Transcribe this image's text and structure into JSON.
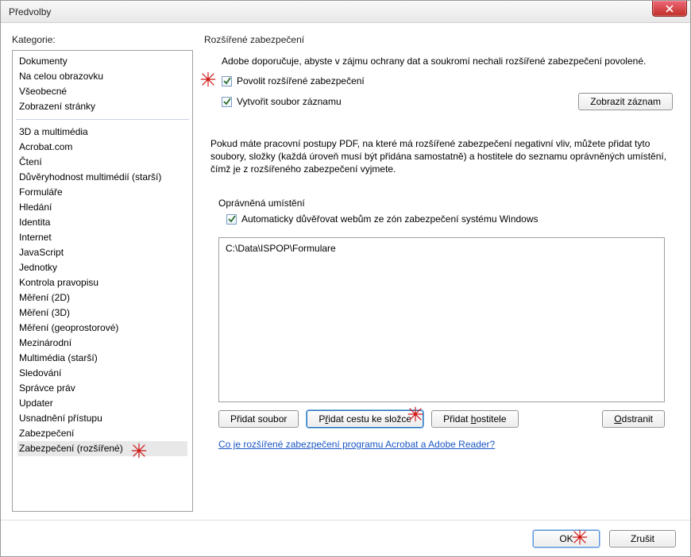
{
  "window": {
    "title": "Předvolby"
  },
  "sidebar": {
    "label": "Kategorie:",
    "group1": [
      "Dokumenty",
      "Na celou obrazovku",
      "Všeobecné",
      "Zobrazení stránky"
    ],
    "group2": [
      "3D a multimédia",
      "Acrobat.com",
      "Čtení",
      "Důvěryhodnost multimédií (starší)",
      "Formuláře",
      "Hledání",
      "Identita",
      "Internet",
      "JavaScript",
      "Jednotky",
      "Kontrola pravopisu",
      "Měření (2D)",
      "Měření (3D)",
      "Měření (geoprostorové)",
      "Mezinárodní",
      "Multimédia (starší)",
      "Sledování",
      "Správce práv",
      "Updater",
      "Usnadnění přístupu",
      "Zabezpečení",
      "Zabezpečení (rozšířené)"
    ],
    "selected": "Zabezpečení (rozšířené)"
  },
  "panel": {
    "title": "Rozšířené zabezpečení",
    "intro": "Adobe doporučuje, abyste v zájmu ochrany dat a soukromí nechali rozšířené zabezpečení povolené.",
    "cb_enable": "Povolit rozšířené zabezpečení",
    "cb_log": "Vytvořit soubor záznamu",
    "btn_showlog": "Zobrazit záznam",
    "desc2": "Pokud máte pracovní postupy PDF, na které má rozšířené zabezpečení negativní vliv, můžete přidat tyto soubory, složky (každá úroveň musí být přidána samostatně) a hostitele do seznamu oprávněných umístění, čímž je z rozšířeného zabezpečení vyjmete.",
    "group_title": "Oprávněná umístění",
    "cb_autotrust": "Automaticky důvěřovat webům ze zón zabezpečení systému Windows",
    "locations": [
      "C:\\Data\\ISPOP\\Formulare"
    ],
    "btn_addfile": "Přidat soubor",
    "btn_addfolder_pre": "P",
    "btn_addfolder_u": "ř",
    "btn_addfolder_post": "idat cestu ke složce",
    "btn_addhost_pre": "Přidat ",
    "btn_addhost_u": "h",
    "btn_addhost_post": "ostitele",
    "btn_remove_pre": "",
    "btn_remove_u": "O",
    "btn_remove_post": "dstranit",
    "link": "Co je rozšířené zabezpečení programu Acrobat a Adobe Reader?"
  },
  "footer": {
    "ok": "OK",
    "cancel": "Zrušit"
  }
}
